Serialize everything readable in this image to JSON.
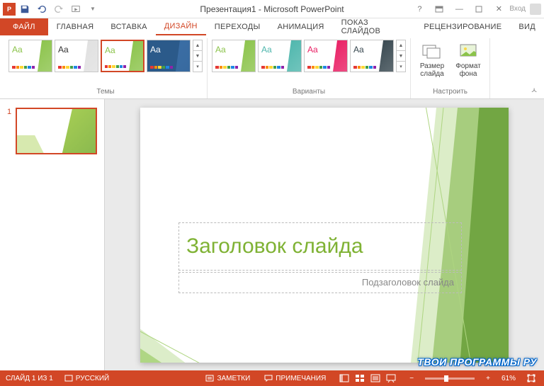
{
  "title": "Презентация1 - Microsoft PowerPoint",
  "login": "Вход",
  "tabs": {
    "file": "ФАЙЛ",
    "home": "ГЛАВНАЯ",
    "insert": "ВСТАВКА",
    "design": "ДИЗАЙН",
    "transitions": "ПЕРЕХОДЫ",
    "animations": "АНИМАЦИЯ",
    "slideshow": "ПОКАЗ СЛАЙДОВ",
    "review": "РЕЦЕНЗИРОВАНИЕ",
    "view": "ВИД"
  },
  "ribbon": {
    "themes_label": "Темы",
    "variants_label": "Варианты",
    "customize_label": "Настроить",
    "slide_size": "Размер слайда",
    "background": "Формат фона"
  },
  "panel": {
    "slide_num": "1"
  },
  "slide": {
    "title": "Заголовок слайда",
    "subtitle": "Подзаголовок слайда"
  },
  "status": {
    "slide_counter": "СЛАЙД 1 ИЗ 1",
    "language": "РУССКИЙ",
    "notes": "ЗАМЕТКИ",
    "comments": "ПРИМЕЧАНИЯ",
    "zoom": "61%"
  },
  "watermark": "ТВОИ ПРОГРАММЫ РУ",
  "colors": {
    "accent": "#d24726",
    "theme_green": "#7fb234"
  },
  "themes": [
    {
      "accent": "#8bc34a",
      "text": "#8bc34a",
      "bg": "#ffffff"
    },
    {
      "accent": "#e0e0e0",
      "text": "#333333",
      "bg": "#ffffff"
    },
    {
      "accent": "#8bc34a",
      "text": "#8bc34a",
      "bg": "#ffffff",
      "selected": true
    },
    {
      "accent": "#3b6ea5",
      "text": "#ffffff",
      "bg": "#2b5a8a"
    }
  ],
  "variants": [
    {
      "accent": "#8bc34a"
    },
    {
      "accent": "#4db6ac"
    },
    {
      "accent": "#e91e63"
    },
    {
      "accent": "#37474f"
    }
  ]
}
